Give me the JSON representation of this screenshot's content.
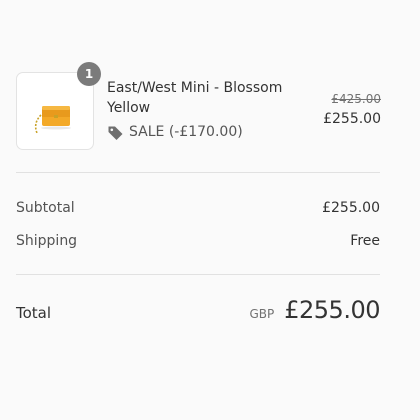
{
  "cart": {
    "item": {
      "quantity": "1",
      "name": "East/West Mini - Blossom Yellow",
      "discount_label": "SALE (-£170.00)",
      "original_price": "£425.00",
      "price": "£255.00",
      "thumbnail_icon": "yellow-handbag",
      "tag_icon": "price-tag-icon"
    }
  },
  "totals": {
    "subtotal_label": "Subtotal",
    "subtotal_value": "£255.00",
    "shipping_label": "Shipping",
    "shipping_value": "Free",
    "total_label": "Total",
    "currency": "GBP",
    "total_value": "£255.00"
  },
  "colors": {
    "badge": "#7b7b7b",
    "product_yellow": "#f3a928"
  }
}
